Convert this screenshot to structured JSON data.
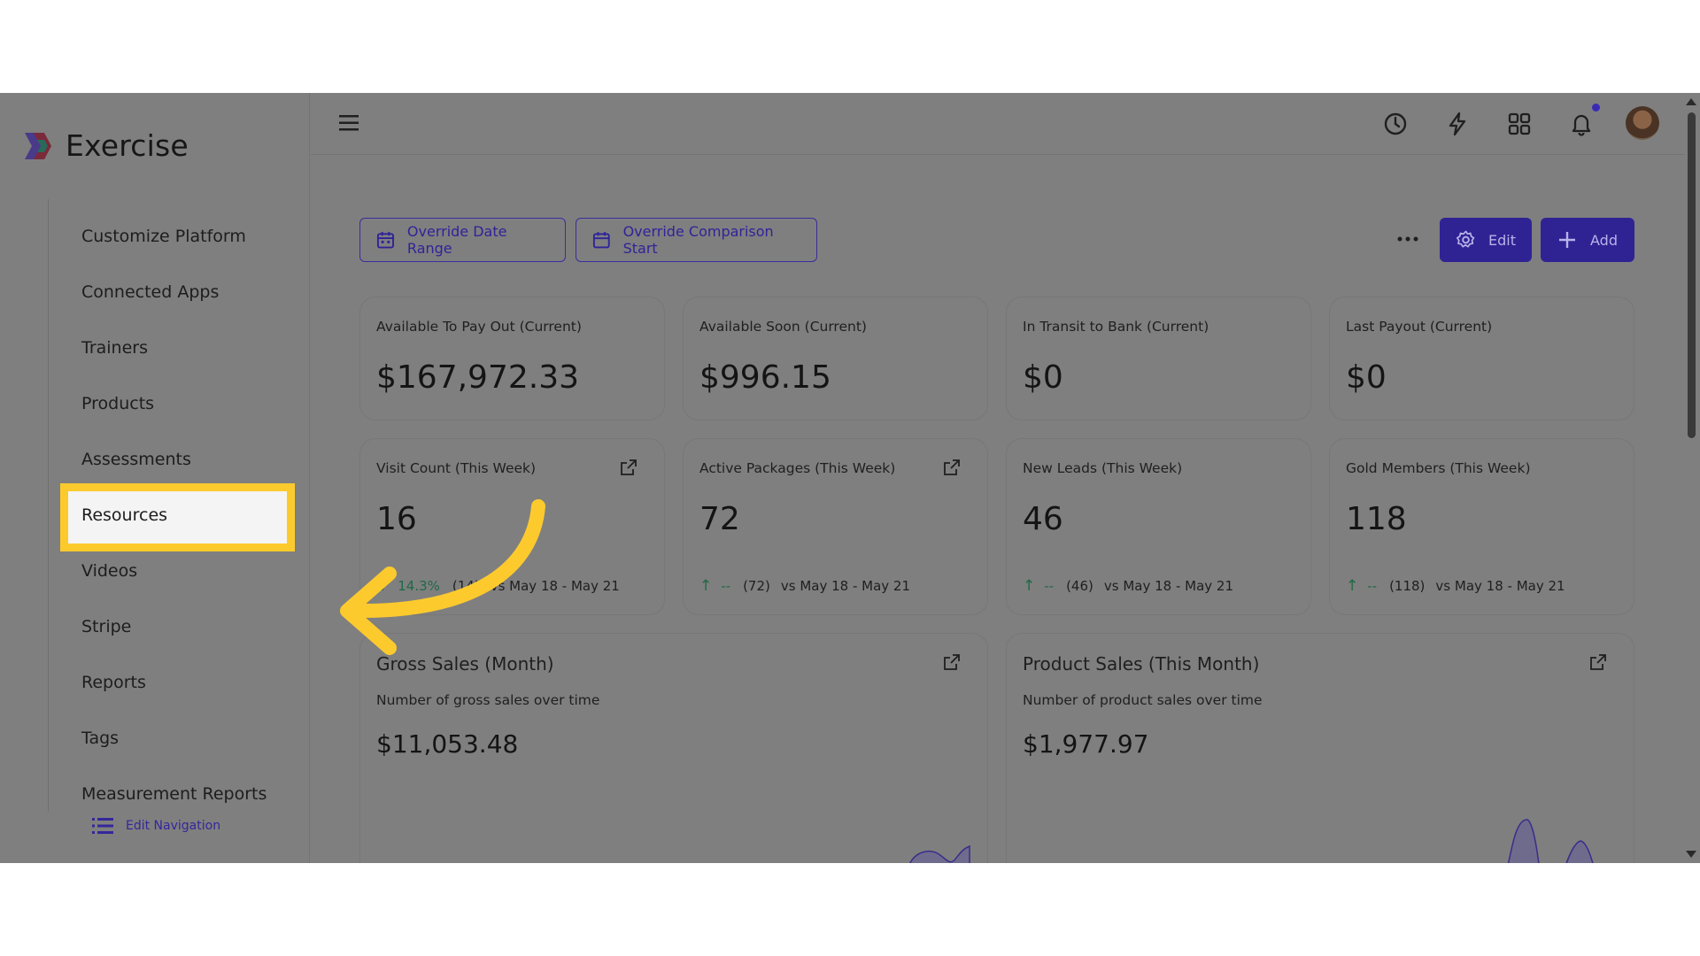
{
  "app": {
    "name": "Exercise"
  },
  "sidebar": {
    "items": [
      {
        "label": "Customize Platform"
      },
      {
        "label": "Connected Apps"
      },
      {
        "label": "Trainers"
      },
      {
        "label": "Products"
      },
      {
        "label": "Assessments"
      },
      {
        "label": "Resources",
        "highlighted": true
      },
      {
        "label": "Videos"
      },
      {
        "label": "Stripe"
      },
      {
        "label": "Reports"
      },
      {
        "label": "Tags"
      },
      {
        "label": "Measurement Reports"
      }
    ],
    "edit_navigation": "Edit Navigation"
  },
  "header": {
    "icons": [
      "menu-icon",
      "clock-icon",
      "lightning-icon",
      "apps-grid-icon",
      "bell-icon",
      "avatar"
    ],
    "notification_dot": true
  },
  "toolbar": {
    "override_date_range": "Override Date Range",
    "override_comparison_start": "Override Comparison Start",
    "edit": "Edit",
    "add": "Add"
  },
  "stats_row1": [
    {
      "label": "Available To Pay Out (Current)",
      "value": "$167,972.33"
    },
    {
      "label": "Available Soon (Current)",
      "value": "$996.15"
    },
    {
      "label": "In Transit to Bank (Current)",
      "value": "$0"
    },
    {
      "label": "Last Payout (Current)",
      "value": "$0"
    }
  ],
  "stats_row2": [
    {
      "label": "Visit Count (This Week)",
      "value": "16",
      "change": "14.3%",
      "previous": "(14)",
      "comparison": "vs May 18 - May 21"
    },
    {
      "label": "Active Packages (This Week)",
      "value": "72",
      "change": "--",
      "previous": "(72)",
      "comparison": "vs May 18 - May 21"
    },
    {
      "label": "New Leads (This Week)",
      "value": "46",
      "change": "--",
      "previous": "(46)",
      "comparison": "vs May 18 - May 21"
    },
    {
      "label": "Gold Members (This Week)",
      "value": "118",
      "change": "--",
      "previous": "(118)",
      "comparison": "vs May 18 - May 21"
    }
  ],
  "gross_sales": {
    "title": "Gross Sales (Month)",
    "subtitle": "Number of gross sales over time",
    "amount": "$11,053.48"
  },
  "product_sales": {
    "title": "Product Sales (This Month)",
    "subtitle": "Number of product sales over time",
    "amount": "$1,977.97"
  },
  "colors": {
    "accent": "#2f2394",
    "highlight": "#fdca2e",
    "trend_up": "#1f6a46",
    "overlay": "#7f7f7f"
  }
}
